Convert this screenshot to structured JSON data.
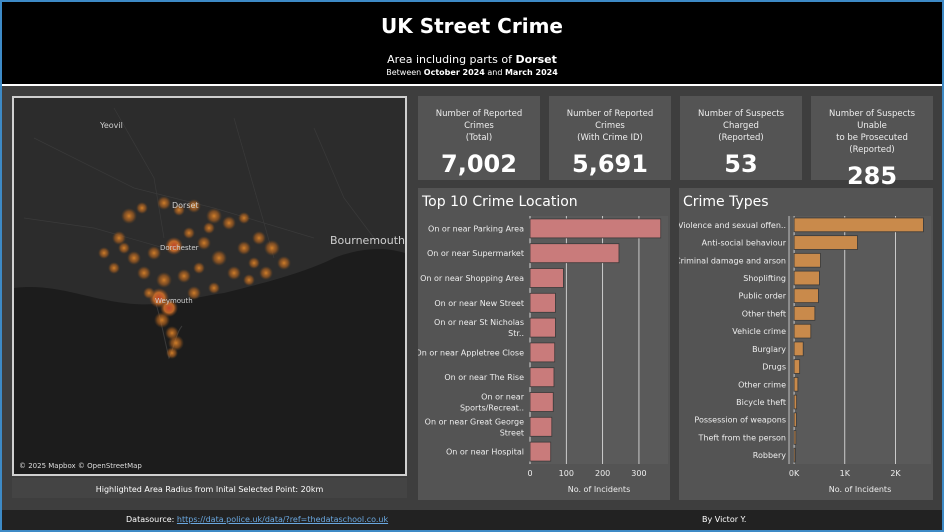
{
  "header": {
    "title": "UK Street Crime",
    "subtitle_prefix": "Area including parts of",
    "area": "Dorset",
    "range_prefix": "Between",
    "start": "October 2024",
    "range_and": "and",
    "end": "March 2024"
  },
  "map": {
    "labels": {
      "yeovil": "Yeovil",
      "dorset": "Dorset",
      "dorchester": "Dorchester",
      "bournemouth": "Bournemouth",
      "weymouth": "Weymouth"
    },
    "attribution": "© 2025 Mapbox © OpenStreetMap",
    "caption": "Highlighted Area Radius from Inital Selected Point: 20km",
    "heat_color": "#e08a2a"
  },
  "kpis": [
    {
      "label_line1": "Number of Reported Crimes",
      "label_line2": "(Total)",
      "value": "7,002"
    },
    {
      "label_line1": "Number of Reported Crimes",
      "label_line2": "(With Crime ID)",
      "value": "5,691"
    },
    {
      "label_line1": "Number of Suspects Charged",
      "label_line2": "(Reported)",
      "value": "53"
    },
    {
      "label_line1": "Number of Suspects Unable",
      "label_line2": "to be Prosecuted (Reported)",
      "value": "285"
    }
  ],
  "chart_data": [
    {
      "type": "bar",
      "orientation": "horizontal",
      "title": "Top 10 Crime Location",
      "xlabel": "No. of Incidents",
      "ylabel": "",
      "xlim": [
        0,
        380
      ],
      "ticks": [
        0,
        100,
        200,
        300
      ],
      "tick_labels": [
        "0",
        "100",
        "200",
        "300"
      ],
      "grid": true,
      "color": "#c97b7b",
      "categories": [
        "On or near Parking Area",
        "On or near Supermarket",
        "On or near Shopping Area",
        "On or near New Street",
        "On or near St Nicholas Str..",
        "On or near Appletree Close",
        "On or near The Rise",
        "On or near Sports/Recreat..",
        "On or near Great George Street",
        "On or near Hospital"
      ],
      "values": [
        360,
        245,
        92,
        70,
        70,
        68,
        66,
        64,
        60,
        57
      ]
    },
    {
      "type": "bar",
      "orientation": "horizontal",
      "title": "Crime Types",
      "xlabel": "No. of Incidents",
      "ylabel": "",
      "xlim": [
        -100,
        2700
      ],
      "ticks": [
        0,
        1000,
        2000
      ],
      "tick_labels": [
        "0K",
        "1K",
        "2K"
      ],
      "grid": true,
      "color": "#c98a4b",
      "categories": [
        "Violence and sexual offen..",
        "Anti-social behaviour",
        "Criminal damage and arson",
        "Shoplifting",
        "Public order",
        "Other theft",
        "Vehicle crime",
        "Burglary",
        "Drugs",
        "Other crime",
        "Bicycle theft",
        "Possession of weapons",
        "Theft from the person",
        "Robbery"
      ],
      "values": [
        2550,
        1250,
        520,
        500,
        480,
        410,
        330,
        180,
        110,
        75,
        50,
        45,
        35,
        25
      ]
    }
  ],
  "footer": {
    "datasource_label": "Datasource:",
    "datasource_url": "https://data.police.uk/data/?ref=thedataschool.co.uk",
    "author": "By Victor Y."
  }
}
